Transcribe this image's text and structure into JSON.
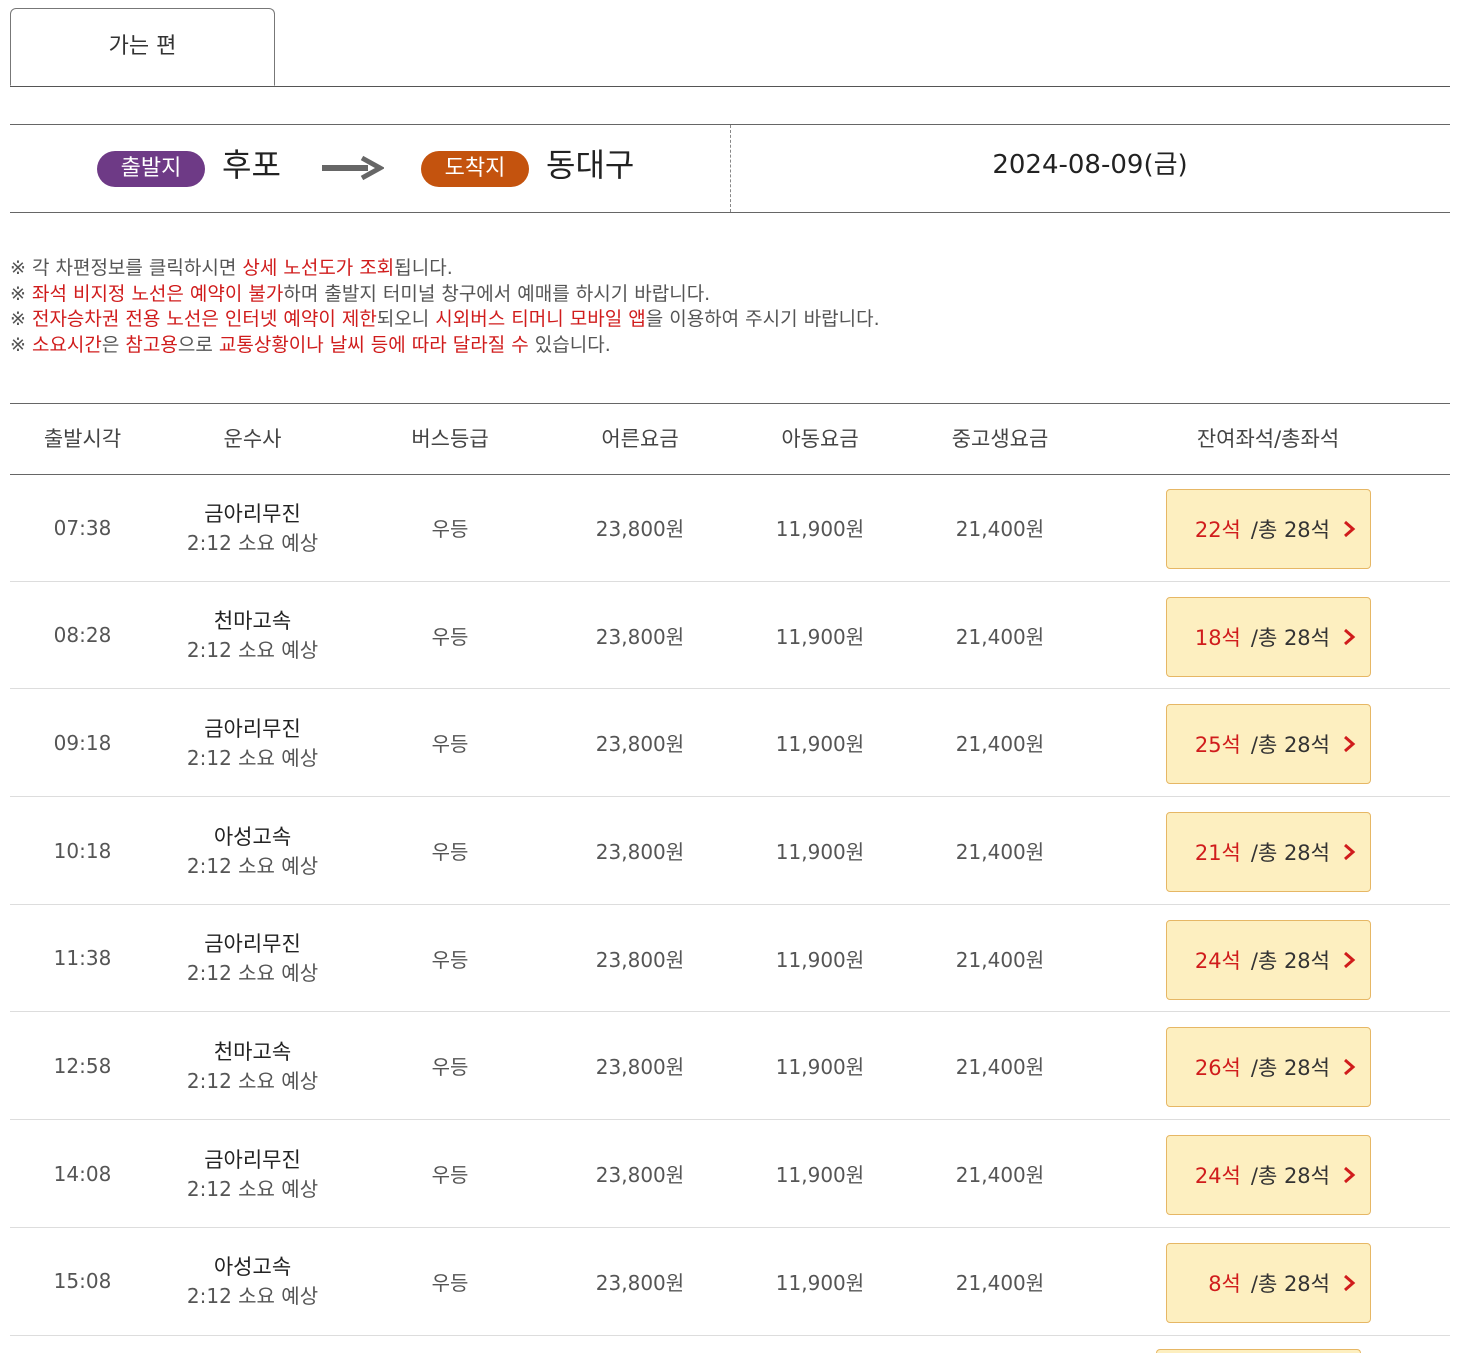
{
  "tab": {
    "label": "가는 편"
  },
  "route": {
    "departure_badge": "출발지",
    "departure_city": "후포",
    "arrival_badge": "도착지",
    "arrival_city": "동대구",
    "date": "2024-08-09(금)",
    "colors": {
      "departure_badge": "#6e3a86",
      "arrival_badge": "#c4530e"
    }
  },
  "notices": [
    [
      {
        "t": "※ 각 차편정보를 클릭하시면 "
      },
      {
        "t": "상세 노선도가 조회",
        "red": true
      },
      {
        "t": "됩니다."
      }
    ],
    [
      {
        "t": "※ "
      },
      {
        "t": "좌석 비지정 노선은 예약이 불가",
        "red": true
      },
      {
        "t": "하며 출발지 터미널 창구에서 예매를 하시기 바랍니다."
      }
    ],
    [
      {
        "t": "※ "
      },
      {
        "t": "전자승차권 전용 노선은 인터넷 예약이 제한",
        "red": true
      },
      {
        "t": "되오니 "
      },
      {
        "t": "시외버스 티머니 모바일 앱",
        "red": true
      },
      {
        "t": "을 이용하여 주시기 바랍니다."
      }
    ],
    [
      {
        "t": "※ "
      },
      {
        "t": "소요시간",
        "red": true
      },
      {
        "t": "은 "
      },
      {
        "t": "참고용",
        "red": true
      },
      {
        "t": "으로 "
      },
      {
        "t": "교통상황이나 날씨 등에 따라 달라질 수",
        "red": true
      },
      {
        "t": " 있습니다."
      }
    ]
  ],
  "table": {
    "headers": {
      "time": "출발시각",
      "company": "운수사",
      "grade": "버스등급",
      "adult": "어른요금",
      "child": "아동요금",
      "student": "중고생요금",
      "seats": "잔여좌석/총좌석"
    },
    "rows": [
      {
        "time": "07:38",
        "company": "금아리무진",
        "duration": "2:12 소요 예상",
        "grade": "우등",
        "adult": "23,800원",
        "child": "11,900원",
        "student": "21,400원",
        "remaining": "22석",
        "total": "/총 28석"
      },
      {
        "time": "08:28",
        "company": "천마고속",
        "duration": "2:12 소요 예상",
        "grade": "우등",
        "adult": "23,800원",
        "child": "11,900원",
        "student": "21,400원",
        "remaining": "18석",
        "total": "/총 28석"
      },
      {
        "time": "09:18",
        "company": "금아리무진",
        "duration": "2:12 소요 예상",
        "grade": "우등",
        "adult": "23,800원",
        "child": "11,900원",
        "student": "21,400원",
        "remaining": "25석",
        "total": "/총 28석"
      },
      {
        "time": "10:18",
        "company": "아성고속",
        "duration": "2:12 소요 예상",
        "grade": "우등",
        "adult": "23,800원",
        "child": "11,900원",
        "student": "21,400원",
        "remaining": "21석",
        "total": "/총 28석"
      },
      {
        "time": "11:38",
        "company": "금아리무진",
        "duration": "2:12 소요 예상",
        "grade": "우등",
        "adult": "23,800원",
        "child": "11,900원",
        "student": "21,400원",
        "remaining": "24석",
        "total": "/총 28석"
      },
      {
        "time": "12:58",
        "company": "천마고속",
        "duration": "2:12 소요 예상",
        "grade": "우등",
        "adult": "23,800원",
        "child": "11,900원",
        "student": "21,400원",
        "remaining": "26석",
        "total": "/총 28석"
      },
      {
        "time": "14:08",
        "company": "금아리무진",
        "duration": "2:12 소요 예상",
        "grade": "우등",
        "adult": "23,800원",
        "child": "11,900원",
        "student": "21,400원",
        "remaining": "24석",
        "total": "/총 28석"
      },
      {
        "time": "15:08",
        "company": "아성고속",
        "duration": "2:12 소요 예상",
        "grade": "우등",
        "adult": "23,800원",
        "child": "11,900원",
        "student": "21,400원",
        "remaining": "8석",
        "total": "/총 28석"
      }
    ]
  },
  "colors": {
    "accent_red": "#d01c1c",
    "seat_button_bg": "#fdefc0",
    "seat_button_border": "#e6b765"
  }
}
